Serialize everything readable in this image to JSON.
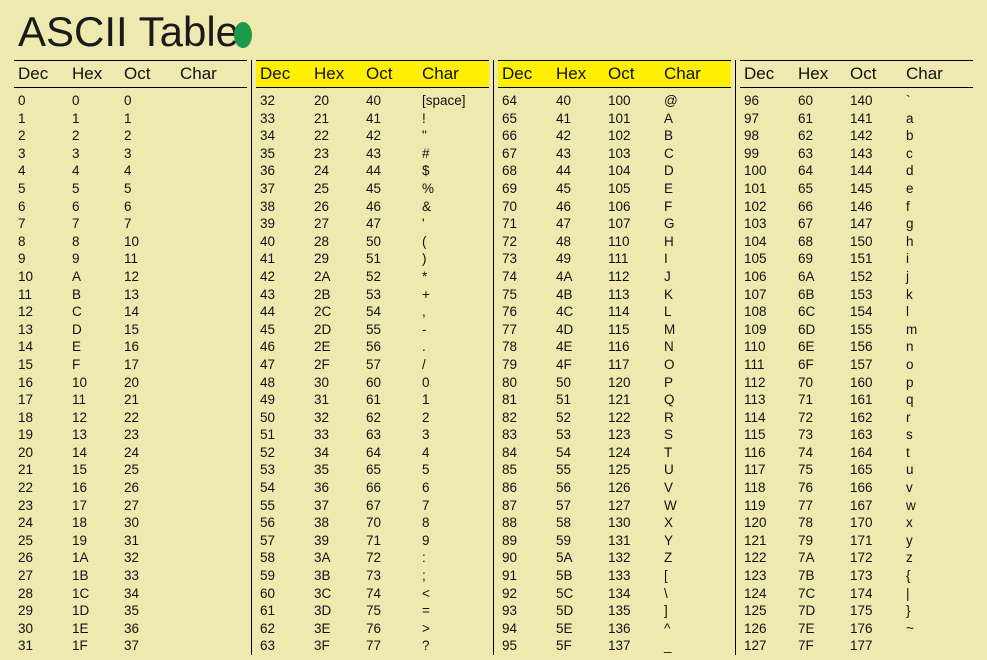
{
  "title": "ASCII Table",
  "columns": [
    {
      "highlight": false
    },
    {
      "highlight": true
    },
    {
      "highlight": true
    },
    {
      "highlight": false
    }
  ],
  "headers": [
    "Dec",
    "Hex",
    "Oct",
    "Char"
  ],
  "chart_data": {
    "type": "table",
    "title": "ASCII Table",
    "columns": [
      "Dec",
      "Hex",
      "Oct",
      "Char"
    ],
    "rows": [
      {
        "dec": 0,
        "hex": "0",
        "oct": "0",
        "char": ""
      },
      {
        "dec": 1,
        "hex": "1",
        "oct": "1",
        "char": ""
      },
      {
        "dec": 2,
        "hex": "2",
        "oct": "2",
        "char": ""
      },
      {
        "dec": 3,
        "hex": "3",
        "oct": "3",
        "char": ""
      },
      {
        "dec": 4,
        "hex": "4",
        "oct": "4",
        "char": ""
      },
      {
        "dec": 5,
        "hex": "5",
        "oct": "5",
        "char": ""
      },
      {
        "dec": 6,
        "hex": "6",
        "oct": "6",
        "char": ""
      },
      {
        "dec": 7,
        "hex": "7",
        "oct": "7",
        "char": ""
      },
      {
        "dec": 8,
        "hex": "8",
        "oct": "10",
        "char": ""
      },
      {
        "dec": 9,
        "hex": "9",
        "oct": "11",
        "char": ""
      },
      {
        "dec": 10,
        "hex": "A",
        "oct": "12",
        "char": ""
      },
      {
        "dec": 11,
        "hex": "B",
        "oct": "13",
        "char": ""
      },
      {
        "dec": 12,
        "hex": "C",
        "oct": "14",
        "char": ""
      },
      {
        "dec": 13,
        "hex": "D",
        "oct": "15",
        "char": ""
      },
      {
        "dec": 14,
        "hex": "E",
        "oct": "16",
        "char": ""
      },
      {
        "dec": 15,
        "hex": "F",
        "oct": "17",
        "char": ""
      },
      {
        "dec": 16,
        "hex": "10",
        "oct": "20",
        "char": ""
      },
      {
        "dec": 17,
        "hex": "11",
        "oct": "21",
        "char": ""
      },
      {
        "dec": 18,
        "hex": "12",
        "oct": "22",
        "char": ""
      },
      {
        "dec": 19,
        "hex": "13",
        "oct": "23",
        "char": ""
      },
      {
        "dec": 20,
        "hex": "14",
        "oct": "24",
        "char": ""
      },
      {
        "dec": 21,
        "hex": "15",
        "oct": "25",
        "char": ""
      },
      {
        "dec": 22,
        "hex": "16",
        "oct": "26",
        "char": ""
      },
      {
        "dec": 23,
        "hex": "17",
        "oct": "27",
        "char": ""
      },
      {
        "dec": 24,
        "hex": "18",
        "oct": "30",
        "char": ""
      },
      {
        "dec": 25,
        "hex": "19",
        "oct": "31",
        "char": ""
      },
      {
        "dec": 26,
        "hex": "1A",
        "oct": "32",
        "char": ""
      },
      {
        "dec": 27,
        "hex": "1B",
        "oct": "33",
        "char": ""
      },
      {
        "dec": 28,
        "hex": "1C",
        "oct": "34",
        "char": ""
      },
      {
        "dec": 29,
        "hex": "1D",
        "oct": "35",
        "char": ""
      },
      {
        "dec": 30,
        "hex": "1E",
        "oct": "36",
        "char": ""
      },
      {
        "dec": 31,
        "hex": "1F",
        "oct": "37",
        "char": ""
      },
      {
        "dec": 32,
        "hex": "20",
        "oct": "40",
        "char": "[space]"
      },
      {
        "dec": 33,
        "hex": "21",
        "oct": "41",
        "char": "!"
      },
      {
        "dec": 34,
        "hex": "22",
        "oct": "42",
        "char": "\""
      },
      {
        "dec": 35,
        "hex": "23",
        "oct": "43",
        "char": "#"
      },
      {
        "dec": 36,
        "hex": "24",
        "oct": "44",
        "char": "$"
      },
      {
        "dec": 37,
        "hex": "25",
        "oct": "45",
        "char": "%"
      },
      {
        "dec": 38,
        "hex": "26",
        "oct": "46",
        "char": "&"
      },
      {
        "dec": 39,
        "hex": "27",
        "oct": "47",
        "char": "'"
      },
      {
        "dec": 40,
        "hex": "28",
        "oct": "50",
        "char": "("
      },
      {
        "dec": 41,
        "hex": "29",
        "oct": "51",
        "char": ")"
      },
      {
        "dec": 42,
        "hex": "2A",
        "oct": "52",
        "char": "*"
      },
      {
        "dec": 43,
        "hex": "2B",
        "oct": "53",
        "char": "+"
      },
      {
        "dec": 44,
        "hex": "2C",
        "oct": "54",
        "char": ","
      },
      {
        "dec": 45,
        "hex": "2D",
        "oct": "55",
        "char": "-"
      },
      {
        "dec": 46,
        "hex": "2E",
        "oct": "56",
        "char": "."
      },
      {
        "dec": 47,
        "hex": "2F",
        "oct": "57",
        "char": "/"
      },
      {
        "dec": 48,
        "hex": "30",
        "oct": "60",
        "char": "0"
      },
      {
        "dec": 49,
        "hex": "31",
        "oct": "61",
        "char": "1"
      },
      {
        "dec": 50,
        "hex": "32",
        "oct": "62",
        "char": "2"
      },
      {
        "dec": 51,
        "hex": "33",
        "oct": "63",
        "char": "3"
      },
      {
        "dec": 52,
        "hex": "34",
        "oct": "64",
        "char": "4"
      },
      {
        "dec": 53,
        "hex": "35",
        "oct": "65",
        "char": "5"
      },
      {
        "dec": 54,
        "hex": "36",
        "oct": "66",
        "char": "6"
      },
      {
        "dec": 55,
        "hex": "37",
        "oct": "67",
        "char": "7"
      },
      {
        "dec": 56,
        "hex": "38",
        "oct": "70",
        "char": "8"
      },
      {
        "dec": 57,
        "hex": "39",
        "oct": "71",
        "char": "9"
      },
      {
        "dec": 58,
        "hex": "3A",
        "oct": "72",
        "char": ":"
      },
      {
        "dec": 59,
        "hex": "3B",
        "oct": "73",
        "char": ";"
      },
      {
        "dec": 60,
        "hex": "3C",
        "oct": "74",
        "char": "<"
      },
      {
        "dec": 61,
        "hex": "3D",
        "oct": "75",
        "char": "="
      },
      {
        "dec": 62,
        "hex": "3E",
        "oct": "76",
        "char": ">"
      },
      {
        "dec": 63,
        "hex": "3F",
        "oct": "77",
        "char": "?"
      },
      {
        "dec": 64,
        "hex": "40",
        "oct": "100",
        "char": "@"
      },
      {
        "dec": 65,
        "hex": "41",
        "oct": "101",
        "char": "A"
      },
      {
        "dec": 66,
        "hex": "42",
        "oct": "102",
        "char": "B"
      },
      {
        "dec": 67,
        "hex": "43",
        "oct": "103",
        "char": "C"
      },
      {
        "dec": 68,
        "hex": "44",
        "oct": "104",
        "char": "D"
      },
      {
        "dec": 69,
        "hex": "45",
        "oct": "105",
        "char": "E"
      },
      {
        "dec": 70,
        "hex": "46",
        "oct": "106",
        "char": "F"
      },
      {
        "dec": 71,
        "hex": "47",
        "oct": "107",
        "char": "G"
      },
      {
        "dec": 72,
        "hex": "48",
        "oct": "110",
        "char": "H"
      },
      {
        "dec": 73,
        "hex": "49",
        "oct": "111",
        "char": "I"
      },
      {
        "dec": 74,
        "hex": "4A",
        "oct": "112",
        "char": "J"
      },
      {
        "dec": 75,
        "hex": "4B",
        "oct": "113",
        "char": "K"
      },
      {
        "dec": 76,
        "hex": "4C",
        "oct": "114",
        "char": "L"
      },
      {
        "dec": 77,
        "hex": "4D",
        "oct": "115",
        "char": "M"
      },
      {
        "dec": 78,
        "hex": "4E",
        "oct": "116",
        "char": "N"
      },
      {
        "dec": 79,
        "hex": "4F",
        "oct": "117",
        "char": "O"
      },
      {
        "dec": 80,
        "hex": "50",
        "oct": "120",
        "char": "P"
      },
      {
        "dec": 81,
        "hex": "51",
        "oct": "121",
        "char": "Q"
      },
      {
        "dec": 82,
        "hex": "52",
        "oct": "122",
        "char": "R"
      },
      {
        "dec": 83,
        "hex": "53",
        "oct": "123",
        "char": "S"
      },
      {
        "dec": 84,
        "hex": "54",
        "oct": "124",
        "char": "T"
      },
      {
        "dec": 85,
        "hex": "55",
        "oct": "125",
        "char": "U"
      },
      {
        "dec": 86,
        "hex": "56",
        "oct": "126",
        "char": "V"
      },
      {
        "dec": 87,
        "hex": "57",
        "oct": "127",
        "char": "W"
      },
      {
        "dec": 88,
        "hex": "58",
        "oct": "130",
        "char": "X"
      },
      {
        "dec": 89,
        "hex": "59",
        "oct": "131",
        "char": "Y"
      },
      {
        "dec": 90,
        "hex": "5A",
        "oct": "132",
        "char": "Z"
      },
      {
        "dec": 91,
        "hex": "5B",
        "oct": "133",
        "char": "["
      },
      {
        "dec": 92,
        "hex": "5C",
        "oct": "134",
        "char": "\\"
      },
      {
        "dec": 93,
        "hex": "5D",
        "oct": "135",
        "char": "]"
      },
      {
        "dec": 94,
        "hex": "5E",
        "oct": "136",
        "char": "^"
      },
      {
        "dec": 95,
        "hex": "5F",
        "oct": "137",
        "char": "_"
      },
      {
        "dec": 96,
        "hex": "60",
        "oct": "140",
        "char": "`"
      },
      {
        "dec": 97,
        "hex": "61",
        "oct": "141",
        "char": "a"
      },
      {
        "dec": 98,
        "hex": "62",
        "oct": "142",
        "char": "b"
      },
      {
        "dec": 99,
        "hex": "63",
        "oct": "143",
        "char": "c"
      },
      {
        "dec": 100,
        "hex": "64",
        "oct": "144",
        "char": "d"
      },
      {
        "dec": 101,
        "hex": "65",
        "oct": "145",
        "char": "e"
      },
      {
        "dec": 102,
        "hex": "66",
        "oct": "146",
        "char": "f"
      },
      {
        "dec": 103,
        "hex": "67",
        "oct": "147",
        "char": "g"
      },
      {
        "dec": 104,
        "hex": "68",
        "oct": "150",
        "char": "h"
      },
      {
        "dec": 105,
        "hex": "69",
        "oct": "151",
        "char": "i"
      },
      {
        "dec": 106,
        "hex": "6A",
        "oct": "152",
        "char": "j"
      },
      {
        "dec": 107,
        "hex": "6B",
        "oct": "153",
        "char": "k"
      },
      {
        "dec": 108,
        "hex": "6C",
        "oct": "154",
        "char": "l"
      },
      {
        "dec": 109,
        "hex": "6D",
        "oct": "155",
        "char": "m"
      },
      {
        "dec": 110,
        "hex": "6E",
        "oct": "156",
        "char": "n"
      },
      {
        "dec": 111,
        "hex": "6F",
        "oct": "157",
        "char": "o"
      },
      {
        "dec": 112,
        "hex": "70",
        "oct": "160",
        "char": "p"
      },
      {
        "dec": 113,
        "hex": "71",
        "oct": "161",
        "char": "q"
      },
      {
        "dec": 114,
        "hex": "72",
        "oct": "162",
        "char": "r"
      },
      {
        "dec": 115,
        "hex": "73",
        "oct": "163",
        "char": "s"
      },
      {
        "dec": 116,
        "hex": "74",
        "oct": "164",
        "char": "t"
      },
      {
        "dec": 117,
        "hex": "75",
        "oct": "165",
        "char": "u"
      },
      {
        "dec": 118,
        "hex": "76",
        "oct": "166",
        "char": "v"
      },
      {
        "dec": 119,
        "hex": "77",
        "oct": "167",
        "char": "w"
      },
      {
        "dec": 120,
        "hex": "78",
        "oct": "170",
        "char": "x"
      },
      {
        "dec": 121,
        "hex": "79",
        "oct": "171",
        "char": "y"
      },
      {
        "dec": 122,
        "hex": "7A",
        "oct": "172",
        "char": "z"
      },
      {
        "dec": 123,
        "hex": "7B",
        "oct": "173",
        "char": "{"
      },
      {
        "dec": 124,
        "hex": "7C",
        "oct": "174",
        "char": "|"
      },
      {
        "dec": 125,
        "hex": "7D",
        "oct": "175",
        "char": "}"
      },
      {
        "dec": 126,
        "hex": "7E",
        "oct": "176",
        "char": "~"
      },
      {
        "dec": 127,
        "hex": "7F",
        "oct": "177",
        "char": ""
      }
    ]
  }
}
